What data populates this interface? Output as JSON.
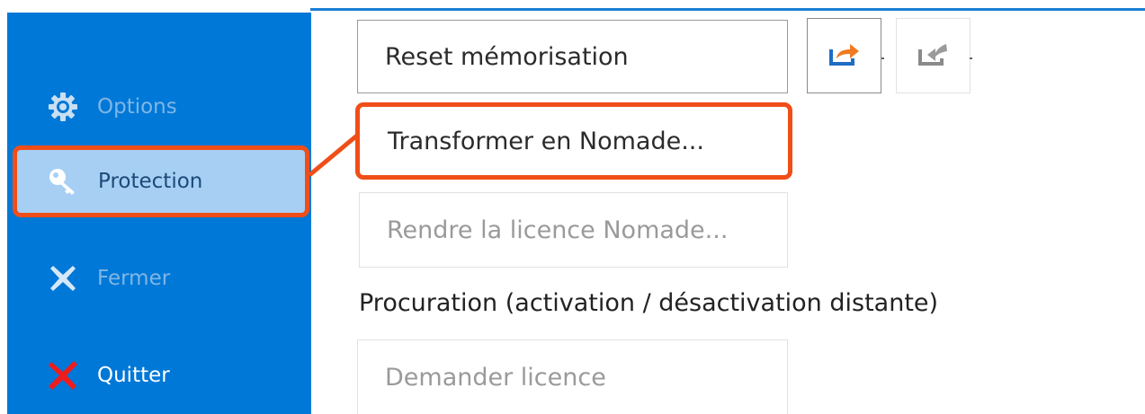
{
  "sidebar": {
    "items": [
      {
        "label": "Options",
        "icon": "gear-icon"
      },
      {
        "label": "Protection",
        "icon": "key-icon",
        "selected": true
      },
      {
        "label": "Fermer",
        "icon": "close-icon"
      },
      {
        "label": "Quitter",
        "icon": "quit-icon"
      }
    ]
  },
  "main": {
    "reset_label": "Reset mémorisation",
    "transform_label": "Transformer en Nomade...",
    "rendre_label": "Rendre la licence Nomade...",
    "procuration_title": "Procuration (activation / désactivation distante)",
    "demander_label": "Demander licence"
  },
  "colors": {
    "sidebar_bg": "#0078d7",
    "selected_bg": "#a7cff4",
    "highlight": "#f04e18"
  }
}
